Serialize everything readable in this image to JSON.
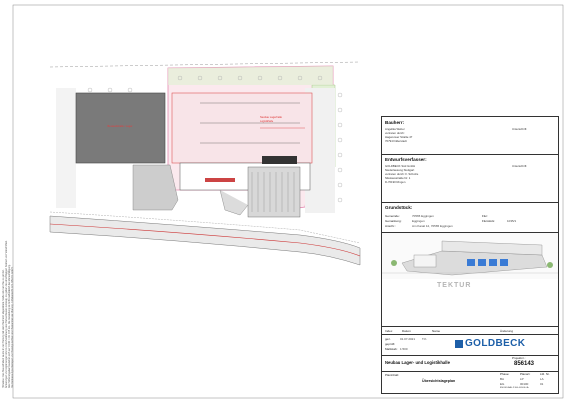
{
  "sheet": {
    "side_notes": [
      "Hinweise: Das Bauvorhaben wurde in der Planung mit dem Bauherrn abgestimmt. Maße sind am Bau zu prüfen.",
      "Änderungen und Ergänzungen sind nur mit Zustimmung des Planverfassers zulässig. Es gelten die einschlägigen Normen und Vorschriften.",
      "Alle Höhenangaben beziehen sich auf ±0,00 = OK FFB EG. Die Darstellung ist nicht maßstäblich bei Vervielfältigung.",
      "Die Vermessungsunterlagen und Bodengutachten sind Bestandteil der Planung. Urheberrecht GOLDBECK GmbH."
    ]
  },
  "plan": {
    "hall_left_label": "Bestandshalle / Lager",
    "hall_main_label": "Neubau Lagerhalle",
    "hall_main_note": "Logistikhalle"
  },
  "titleblock": {
    "bauherr": {
      "title": "Bauherr:",
      "lines": [
        "Angelika Weber",
        "vertreten durch:",
        "Hagenower Straße 47",
        "70794 Filderstadt"
      ],
      "signature_label": "Unterschrift:"
    },
    "entwurf": {
      "title": "Entwurfsverfasser:",
      "lines": [
        "GOLDBECK Süd GmbH",
        "Niederlassung Stuttgart",
        "vertreten durch: F. Schulze",
        "Nikolausstraße Nr. 1",
        "D-70190 Ringen"
      ],
      "signature_label": "Unterschrift:"
    },
    "grundstueck": {
      "title": "Grundstück:",
      "rows": [
        {
          "label": "Gemeinde:",
          "value": "70565 Eggingen"
        },
        {
          "label": "Gemarkung:",
          "value": "Eggingen"
        },
        {
          "label": "Anschr.:",
          "value": "Am Kanal 12, 70565 Eggingen"
        }
      ],
      "right_rows": [
        {
          "label": "Flur:",
          "value": ""
        },
        {
          "label": "Flurstück:",
          "value": "1035/1"
        }
      ]
    },
    "watermark": "TEKTUR",
    "rev_table": {
      "headers": [
        "Index",
        "Datum",
        "Name",
        "Änderung"
      ],
      "rows": [
        [
          "gez.",
          "01.07.2021",
          "T.K."
        ],
        [
          "geprüft:",
          "",
          ""
        ],
        [
          "Maßstab:",
          "1:500",
          ""
        ]
      ]
    },
    "company": {
      "name": "GOLDBECK",
      "sub1": "GOLDBECK SÜD GMBH · STUTTGART · FON 0711 / 78 95 60 · FAX",
      "sub2": "WWW.GOLDBECK.DE · INFO@GOLDBECK.DE"
    },
    "project": {
      "title": "Neubau Lager- und Logistikhalle",
      "number_label": "Projektnr.:",
      "number": "856143",
      "plan_label": "Planinhalt:",
      "plan_name": "Übersichtslageplan"
    },
    "footer": {
      "headers": [
        "Phase:",
        "Planart:",
        "Lfd. Nr."
      ],
      "row1": [
        "BA",
        "LP",
        "LA"
      ],
      "row2": [
        "EG",
        "00100",
        "01"
      ],
      "code": "856143-BA-LP-EG-00100-LA"
    }
  }
}
